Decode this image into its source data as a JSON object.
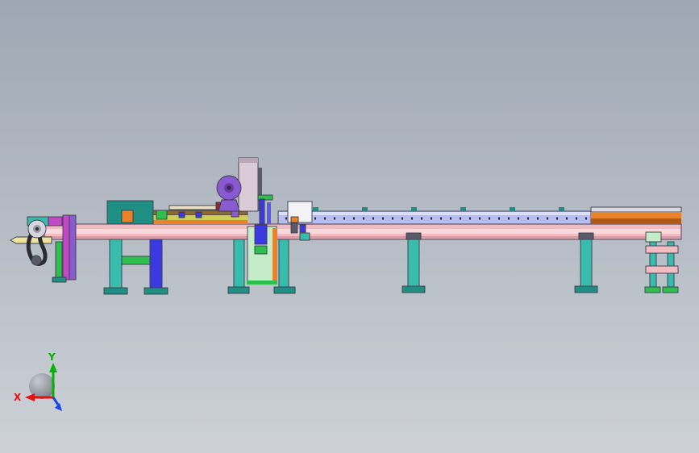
{
  "palette": {
    "bg_top": "#9ea7b3",
    "bg_bottom": "#cdd1d7",
    "outline": "#3c3c4c",
    "beam_pink": "#f3bcc3",
    "beam_pink_light": "#fad9dd",
    "beam_pink_dark": "#df98a5",
    "rail_lavender": "#b6bdf0",
    "rail_lavender_light": "#dadef8",
    "rail_orange": "#e8832a",
    "rail_orange_dark": "#b05a18",
    "rail_yellow": "#cfcf58",
    "rail_brown": "#8a6a2e",
    "beige": "#e8e0c0",
    "silver": "#d9dade",
    "teal": "#38bcab",
    "teal_dark": "#1f8f84",
    "green": "#2fbf4f",
    "light_green": "#c4ecc9",
    "blue": "#3a3ae0",
    "blue_light": "#5a5ae8",
    "purple": "#8a5ad0",
    "purple_dark": "#6a3aa8",
    "magenta": "#c24ac4",
    "gray_light": "#d6d6de",
    "gray_mid": "#9a9aa6",
    "column_gray": "#d9ccd6",
    "column_gray_dark": "#b8a8b6",
    "white_box": "#f3f3f5",
    "dark_red": "#8a2a2a",
    "yellow_rod": "#efe49c",
    "chain_dark": "#2b2b33",
    "slate": "#5a5a6a",
    "axis_x": "#e01212",
    "axis_y": "#00b400",
    "axis_z": "#1545e8",
    "sphere_light": "#c6cbd2",
    "sphere_dark": "#6e747e"
  },
  "triad": {
    "x_label": "X",
    "y_label": "Y"
  }
}
